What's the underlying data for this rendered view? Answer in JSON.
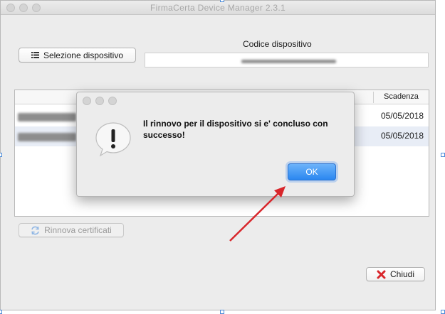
{
  "window": {
    "title": "FirmaCerta Device Manager 2.3.1"
  },
  "toolbar": {
    "select_device_label": "Selezione dispositivo"
  },
  "device_code": {
    "label": "Codice dispositivo"
  },
  "table": {
    "columns": [
      "Scadenza"
    ],
    "rows": [
      {
        "scadenza": "05/05/2018",
        "selected": false
      },
      {
        "scadenza": "05/05/2018",
        "selected": true
      }
    ]
  },
  "actions": {
    "renew_label": "Rinnova certificati",
    "close_label": "Chiudi"
  },
  "dialog": {
    "message": "Il rinnovo per il dispositivo si e' concluso con successo!",
    "ok_label": "OK"
  },
  "colors": {
    "ok_button": "#2a87f0",
    "close_icon": "#d9262b",
    "renew_icon": "#4a90d9",
    "arrow": "#d8262b"
  },
  "icons": [
    "list-icon",
    "refresh-icon",
    "close-x-icon",
    "alert-icon"
  ]
}
